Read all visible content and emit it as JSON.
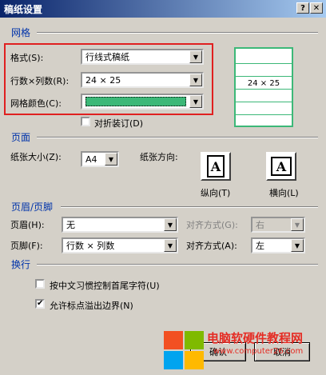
{
  "window": {
    "title": "稿纸设置",
    "help_label": "?"
  },
  "grid": {
    "section_title": "网格",
    "format_label": "格式(S):",
    "format_value": "行线式稿纸",
    "rows_cols_label": "行数×列数(R):",
    "rows_cols_value": "24 × 25",
    "color_label": "网格颜色(C):",
    "color_value": "#3cb878",
    "fold_label": "对折装订(D)",
    "fold_checked": false,
    "preview_text": "24 × 25"
  },
  "page": {
    "section_title": "页面",
    "paper_size_label": "纸张大小(Z):",
    "paper_size_value": "A4",
    "orientation_label": "纸张方向:",
    "portrait_label": "纵向(T)",
    "landscape_label": "横向(L)",
    "orientation_icon_letter": "A"
  },
  "header_footer": {
    "section_title": "页眉/页脚",
    "header_label": "页眉(H):",
    "header_value": "无",
    "header_align_label": "对齐方式(G):",
    "header_align_value": "右",
    "footer_label": "页脚(F):",
    "footer_value": "行数 × 列数",
    "footer_align_label": "对齐方式(A):",
    "footer_align_value": "左"
  },
  "wrap": {
    "section_title": "换行",
    "cb1_label": "按中文习惯控制首尾字符(U)",
    "cb1_checked": false,
    "cb2_label": "允许标点溢出边界(N)",
    "cb2_checked": true,
    "checkmark": "✔"
  },
  "buttons": {
    "ok": "确认",
    "cancel": "取消"
  },
  "watermark": {
    "line1": "电脑软硬件教程网",
    "line2": "www.computer26.com"
  },
  "icons": {
    "dropdown": "▼"
  },
  "colors": {
    "accent_red": "#e02020",
    "section_blue": "#0033aa",
    "grid_green": "#3cb878"
  }
}
